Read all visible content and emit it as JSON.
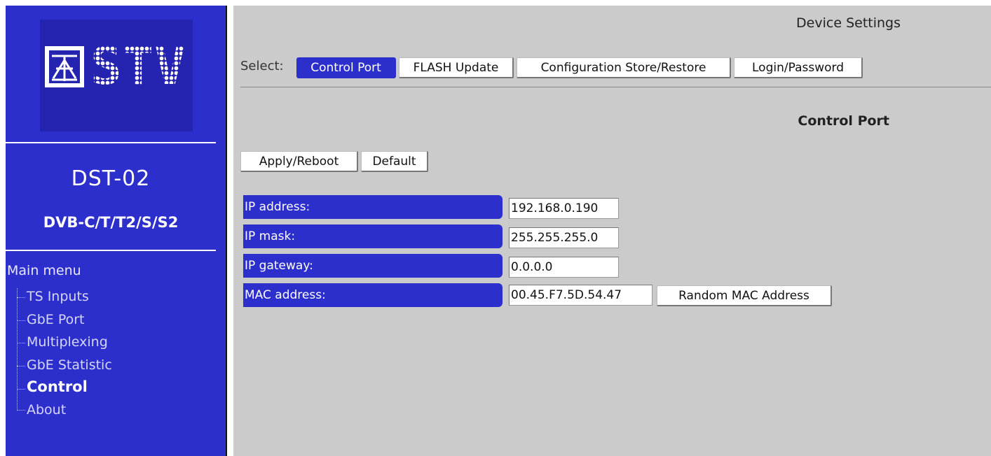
{
  "sidebar": {
    "logo_text": "STV",
    "model": "DST-02",
    "standards": "DVB-C/T/T2/S/S2",
    "menu_title": "Main menu",
    "menu_items": [
      {
        "label": "TS Inputs",
        "active": false
      },
      {
        "label": "GbE Port",
        "active": false
      },
      {
        "label": "Multiplexing",
        "active": false
      },
      {
        "label": "GbE Statistic",
        "active": false
      },
      {
        "label": "Control",
        "active": true
      },
      {
        "label": "About",
        "active": false
      }
    ]
  },
  "main": {
    "title": "Device Settings",
    "select_label": "Select:",
    "tabs": [
      {
        "label": "Control Port",
        "active": true
      },
      {
        "label": "FLASH Update",
        "active": false
      },
      {
        "label": "Configuration Store/Restore",
        "active": false
      },
      {
        "label": "Login/Password",
        "active": false
      }
    ],
    "section_title": "Control Port",
    "buttons": {
      "apply_reboot": "Apply/Reboot",
      "default": "Default",
      "random_mac": "Random MAC Address"
    },
    "fields": [
      {
        "label": "IP address:",
        "value": "192.168.0.190"
      },
      {
        "label": "IP mask:",
        "value": "255.255.255.0"
      },
      {
        "label": "IP gateway:",
        "value": "0.0.0.0"
      },
      {
        "label": "MAC address:",
        "value": "00.45.F7.5D.54.47"
      }
    ]
  },
  "colors": {
    "accent_blue": "#2c2fcc",
    "panel_gray": "#cbcbcb"
  }
}
